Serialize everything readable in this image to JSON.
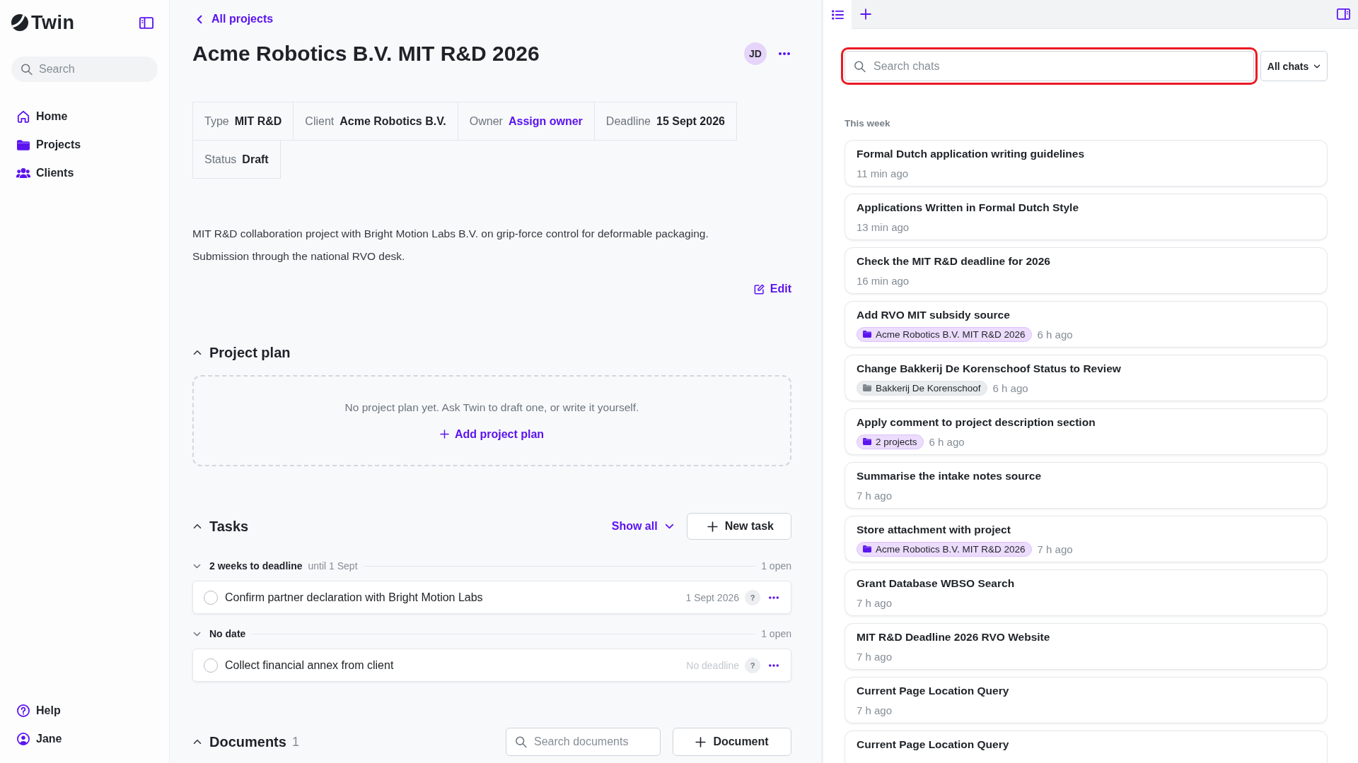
{
  "sidebar": {
    "logo": "Twin",
    "search": {
      "placeholder": "Search"
    },
    "nav": [
      {
        "label": "Home"
      },
      {
        "label": "Projects"
      },
      {
        "label": "Clients"
      }
    ],
    "footer": [
      {
        "label": "Help"
      },
      {
        "label": "Jane"
      }
    ]
  },
  "project": {
    "back_link": "All projects",
    "title": "Acme Robotics B.V. MIT R&D 2026",
    "avatar": "JD",
    "meta": [
      {
        "label": "Type",
        "value": "MIT R&D",
        "kind": "text"
      },
      {
        "label": "Client",
        "value": "Acme Robotics B.V.",
        "kind": "text"
      },
      {
        "label": "Owner",
        "value": "Assign owner",
        "kind": "link"
      },
      {
        "label": "Deadline",
        "value": "15 Sept 2026",
        "kind": "text"
      },
      {
        "label": "Status",
        "value": "Draft",
        "kind": "text"
      }
    ],
    "description": "MIT R&D collaboration project with Bright Motion Labs B.V. on grip-force control for deformable packaging.\nSubmission through the national RVO desk.",
    "edit": "Edit"
  },
  "project_plan": {
    "title": "Project plan",
    "expanded": true,
    "empty_text": "No project plan yet. Ask Twin to draft one, or write it yourself.",
    "add_button": "Add project plan"
  },
  "tasks": {
    "title": "Tasks",
    "expanded": true,
    "filter": "Show all",
    "new_button": "New task",
    "groups": [
      {
        "title": "2 weeks to deadline",
        "subtitle": "until 1 Sept",
        "count": "1 open",
        "expanded": true,
        "items": [
          {
            "text": "Confirm partner declaration with Bright Motion Labs",
            "due": "1 Sept 2026",
            "due_set": true,
            "assignee": "?",
            "done": false
          }
        ]
      },
      {
        "title": "No date",
        "count": "1 open",
        "expanded": true,
        "items": [
          {
            "text": "Collect financial annex from client",
            "due": "No deadline",
            "due_set": false,
            "assignee": "?",
            "done": false
          }
        ]
      }
    ]
  },
  "documents": {
    "title": "Documents",
    "count": "1",
    "expanded": true,
    "search": {
      "placeholder": "Search documents"
    },
    "new_button": "Document"
  },
  "chat_panel": {
    "tabs": [
      {
        "selected": true
      },
      {
        "selected": false
      }
    ],
    "search": {
      "placeholder": "Search chats",
      "highlighted": true
    },
    "filter": "All chats",
    "section": "This week",
    "chats": [
      {
        "title": "Formal Dutch application writing guidelines",
        "time": "11 min ago"
      },
      {
        "title": "Applications Written in Formal Dutch Style",
        "time": "13 min ago"
      },
      {
        "title": "Check the MIT R&D deadline for 2026",
        "time": "16 min ago"
      },
      {
        "title": "Add RVO MIT subsidy source",
        "tags": [
          {
            "label": "Acme Robotics B.V. MIT R&D 2026",
            "kind": "project"
          }
        ],
        "time": "6 h ago"
      },
      {
        "title": "Change Bakkerij De Korenschoof Status to Review",
        "tags": [
          {
            "label": "Bakkerij De Korenschoof",
            "kind": "client"
          }
        ],
        "time": "6 h ago"
      },
      {
        "title": "Apply comment to project description section",
        "tags": [
          {
            "label": "2 projects",
            "kind": "project"
          }
        ],
        "time": "6 h ago"
      },
      {
        "title": "Summarise the intake notes source",
        "time": "7 h ago"
      },
      {
        "title": "Store attachment with project",
        "tags": [
          {
            "label": "Acme Robotics B.V. MIT R&D 2026",
            "kind": "project"
          }
        ],
        "time": "7 h ago"
      },
      {
        "title": "Grant Database WBSO Search",
        "time": "7 h ago"
      },
      {
        "title": "MIT R&D Deadline 2026 RVO Website",
        "time": "7 h ago"
      },
      {
        "title": "Current Page Location Query",
        "time": "7 h ago"
      },
      {
        "title": "Current Page Location Query"
      }
    ]
  }
}
